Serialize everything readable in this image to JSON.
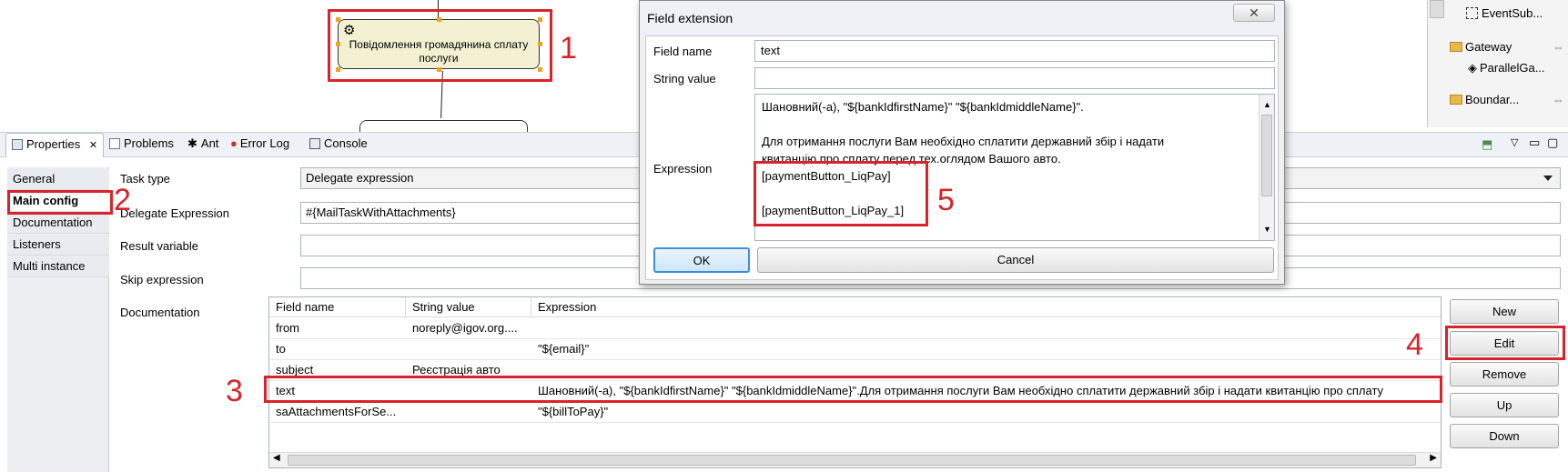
{
  "diagram": {
    "task_label": "Повідомлення громадянина сплату послуги"
  },
  "palette": {
    "items": [
      "EventSub...",
      "Gateway",
      "ParallelGa...",
      "Boundar..."
    ]
  },
  "tabs": [
    {
      "label": "Properties"
    },
    {
      "label": "Problems"
    },
    {
      "label": "Ant"
    },
    {
      "label": "Error Log"
    },
    {
      "label": "Console"
    }
  ],
  "sidenav": {
    "items": [
      "General",
      "Main config",
      "Documentation",
      "Listeners",
      "Multi instance"
    ]
  },
  "form": {
    "task_type_label": "Task type",
    "task_type_value": "Delegate expression",
    "delegate_label": "Delegate Expression",
    "delegate_value": "#{MailTaskWithAttachments}",
    "result_label": "Result variable",
    "result_value": "",
    "skip_label": "Skip expression",
    "skip_value": "",
    "doc_label": "Documentation"
  },
  "table": {
    "headers": [
      "Field name",
      "String value",
      "Expression"
    ],
    "rows": [
      {
        "field": "from",
        "string": "noreply@igov.org....",
        "expr": ""
      },
      {
        "field": "to",
        "string": "",
        "expr": "\"${email}\""
      },
      {
        "field": "subject",
        "string": "Реєстрація авто",
        "expr": ""
      },
      {
        "field": "text",
        "string": "",
        "expr": "Шановний(-а), \"${bankIdfirstName}\" \"${bankIdmiddleName}\".Для отримання послуги Вам необхідно сплатити державний збір і  надати квитанцію про сплату"
      },
      {
        "field": "saAttachmentsForSe...",
        "string": "",
        "expr": "\"${billToPay}\""
      }
    ]
  },
  "buttons": {
    "new": "New",
    "edit": "Edit",
    "remove": "Remove",
    "up": "Up",
    "down": "Down"
  },
  "dialog": {
    "title": "Field extension",
    "close": "✕",
    "field_name_label": "Field name",
    "field_name_value": "text",
    "string_value_label": "String value",
    "string_value_value": "",
    "expression_label": "Expression",
    "expression_lines": [
      "Шановний(-а), \"${bankIdfirstName}\" \"${bankIdmiddleName}\".",
      "",
      "Для отримання послуги Вам необхідно сплатити державний збір і  надати",
      "квитанцію про сплату перед тех.оглядом Вашого авто.",
      "[paymentButton_LiqPay]",
      "",
      "[paymentButton_LiqPay_1]"
    ],
    "ok": "OK",
    "cancel": "Cancel"
  },
  "annotations": [
    "1",
    "2",
    "3",
    "4",
    "5"
  ],
  "colors": {
    "annotation_red": "#d8232a",
    "task_fill": "#f4f1d2",
    "handle_orange": "#f5a020"
  }
}
